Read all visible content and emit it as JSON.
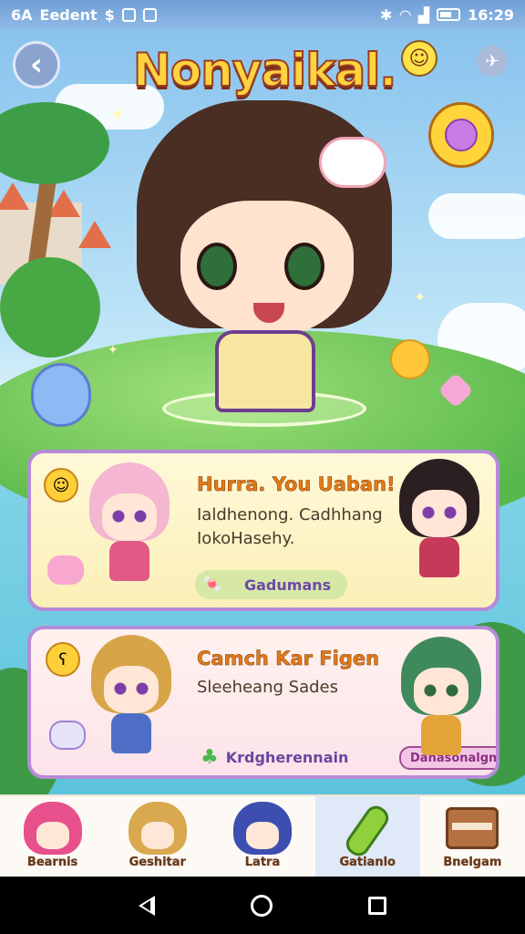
{
  "status_bar": {
    "left_text_1": "6A",
    "left_text_2": "Eedent",
    "left_icons": [
      "dollar-icon",
      "notification-icon",
      "message-icon"
    ],
    "right_icons": [
      "bluetooth-icon",
      "wifi-icon",
      "signal-icon",
      "battery-icon"
    ],
    "time": "16:29"
  },
  "header": {
    "title": "Nonyaikal.",
    "back_icon": "chevron-left-icon",
    "settings_icon": "pin-icon"
  },
  "cards": [
    {
      "title": "Hurra. You Uaban!",
      "line1": "Ialdhenong. Cadhhang",
      "line2": "IokoHasehy.",
      "pill_label": "Gadumans"
    },
    {
      "title": "Camch Kar Figen",
      "line1": "Sleeheang Sades",
      "link_label": "Krdgherennain",
      "tag_label": "Danasonalgn"
    }
  ],
  "bottom_nav": [
    {
      "label": "Bearnis",
      "active": false
    },
    {
      "label": "Geshitar",
      "active": false
    },
    {
      "label": "Latra",
      "active": false
    },
    {
      "label": "Gatianlo",
      "active": true
    },
    {
      "label": "Bnelgam",
      "active": false
    }
  ],
  "colors": {
    "accent_title": "#ffd23f",
    "card_border": "#b58bd8",
    "card_title": "#e27a17",
    "nav_active": "#dfe9f7"
  }
}
